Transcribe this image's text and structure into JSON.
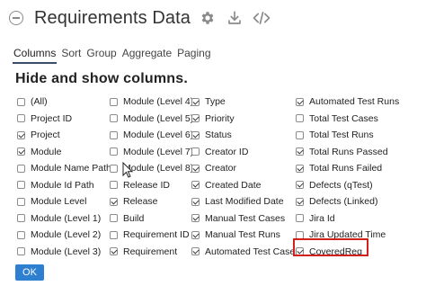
{
  "header": {
    "title": "Requirements Data",
    "icons": [
      "collapse-icon",
      "gear-icon",
      "download-icon",
      "code-icon"
    ]
  },
  "tabs": [
    {
      "label": "Columns",
      "active": true
    },
    {
      "label": "Sort",
      "active": false
    },
    {
      "label": "Group",
      "active": false
    },
    {
      "label": "Aggregate",
      "active": false
    },
    {
      "label": "Paging",
      "active": false
    }
  ],
  "section_title": "Hide and show columns.",
  "columns": [
    [
      {
        "label": "(All)",
        "checked": false
      },
      {
        "label": "Project ID",
        "checked": false
      },
      {
        "label": "Project",
        "checked": true
      },
      {
        "label": "Module",
        "checked": true
      },
      {
        "label": "Module Name Path",
        "checked": false
      },
      {
        "label": "Module Id Path",
        "checked": false
      },
      {
        "label": "Module Level",
        "checked": false
      },
      {
        "label": "Module (Level 1)",
        "checked": false
      },
      {
        "label": "Module (Level 2)",
        "checked": false
      },
      {
        "label": "Module (Level 3)",
        "checked": false
      }
    ],
    [
      {
        "label": "Module (Level 4)",
        "checked": false
      },
      {
        "label": "Module (Level 5)",
        "checked": false
      },
      {
        "label": "Module (Level 6)",
        "checked": false
      },
      {
        "label": "Module (Level 7)",
        "checked": false
      },
      {
        "label": "Module (Level 8)",
        "checked": false
      },
      {
        "label": "Release ID",
        "checked": false
      },
      {
        "label": "Release",
        "checked": true
      },
      {
        "label": "Build",
        "checked": false
      },
      {
        "label": "Requirement ID",
        "checked": false
      },
      {
        "label": "Requirement",
        "checked": true
      }
    ],
    [
      {
        "label": "Type",
        "checked": true
      },
      {
        "label": "Priority",
        "checked": true
      },
      {
        "label": "Status",
        "checked": true
      },
      {
        "label": "Creator ID",
        "checked": false
      },
      {
        "label": "Creator",
        "checked": true
      },
      {
        "label": "Created Date",
        "checked": true
      },
      {
        "label": "Last Modified Date",
        "checked": true
      },
      {
        "label": "Manual Test Cases",
        "checked": true
      },
      {
        "label": "Manual Test Runs",
        "checked": true
      },
      {
        "label": "Automated Test Cases",
        "checked": true
      }
    ],
    [
      {
        "label": "Automated Test Runs",
        "checked": true
      },
      {
        "label": "Total Test Cases",
        "checked": false
      },
      {
        "label": "Total Test Runs",
        "checked": false
      },
      {
        "label": "Total Runs Passed",
        "checked": true
      },
      {
        "label": "Total Runs Failed",
        "checked": true
      },
      {
        "label": "Defects (qTest)",
        "checked": true
      },
      {
        "label": "Defects (Linked)",
        "checked": true
      },
      {
        "label": "Jira Id",
        "checked": false
      },
      {
        "label": "Jira Updated Time",
        "checked": false
      },
      {
        "label": "CoveredReq",
        "checked": true
      }
    ]
  ],
  "ok_label": "OK",
  "highlight_color": "#d41f1f",
  "accent_color": "#2f7fd1"
}
